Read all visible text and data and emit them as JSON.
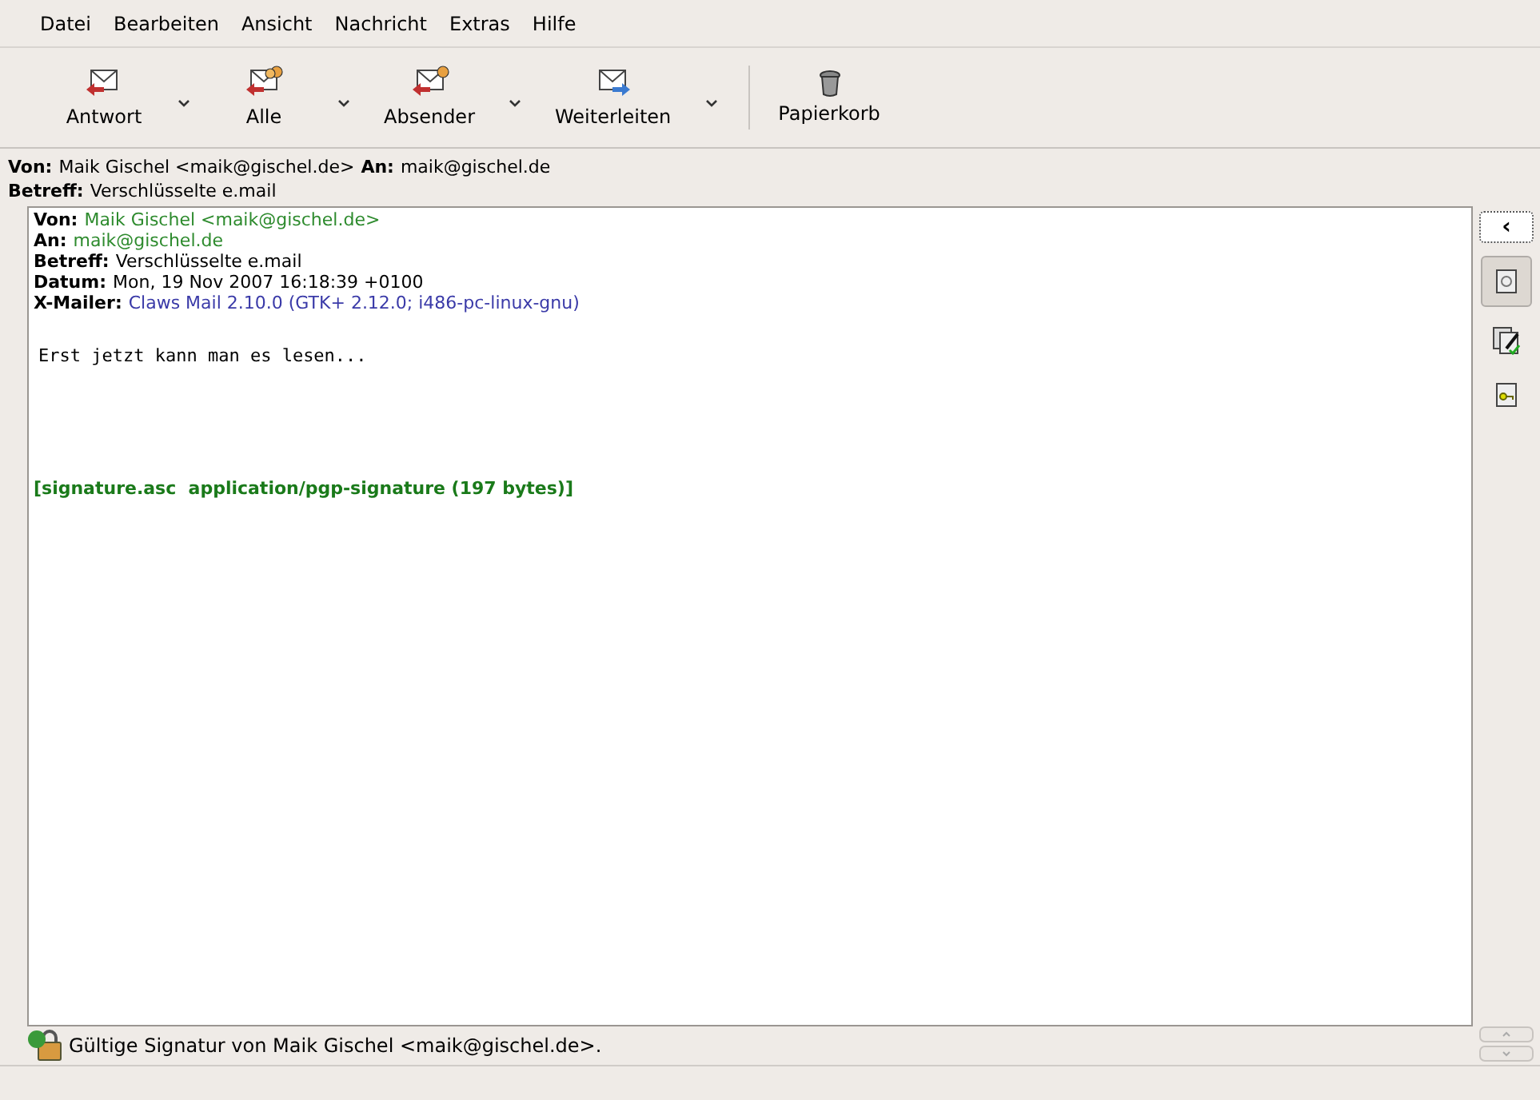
{
  "menu": [
    "Datei",
    "Bearbeiten",
    "Ansicht",
    "Nachricht",
    "Extras",
    "Hilfe"
  ],
  "toolbar": [
    {
      "label": "Antwort",
      "dropdown": true
    },
    {
      "label": "Alle",
      "dropdown": true
    },
    {
      "label": "Absender",
      "dropdown": true
    },
    {
      "label": "Weiterleiten",
      "dropdown": true
    },
    {
      "label": "Papierkorb",
      "dropdown": false
    }
  ],
  "summary": {
    "from_label": "Von:",
    "from": "Maik Gischel <maik@gischel.de>",
    "to_label": "An:",
    "to": "maik@gischel.de",
    "subject_label": "Betreff:",
    "subject": "Verschlüsselte e.mail"
  },
  "headers": [
    {
      "label": "Von:",
      "value": "Maik Gischel <maik@gischel.de>",
      "color": "#2e8b2e"
    },
    {
      "label": "An:",
      "value": "maik@gischel.de",
      "color": "#2e8b2e"
    },
    {
      "label": "Betreff:",
      "value": "Verschlüsselte e.mail",
      "color": "#000000"
    },
    {
      "label": "Datum:",
      "value": "Mon, 19 Nov 2007 16:18:39 +0100",
      "color": "#000000"
    },
    {
      "label": "X-Mailer:",
      "value": "Claws Mail 2.10.0 (GTK+ 2.12.0; i486-pc-linux-gnu)",
      "color": "#3a3aa8"
    }
  ],
  "body": "Erst jetzt kann man es lesen...",
  "attachment_line": "[signature.asc  application/pgp-signature (197 bytes)]",
  "side_toggle": "‹",
  "parts": [
    {
      "selected": true
    },
    {
      "selected": false
    },
    {
      "selected": false
    }
  ],
  "status": "Gültige Signatur von Maik Gischel <maik@gischel.de>."
}
